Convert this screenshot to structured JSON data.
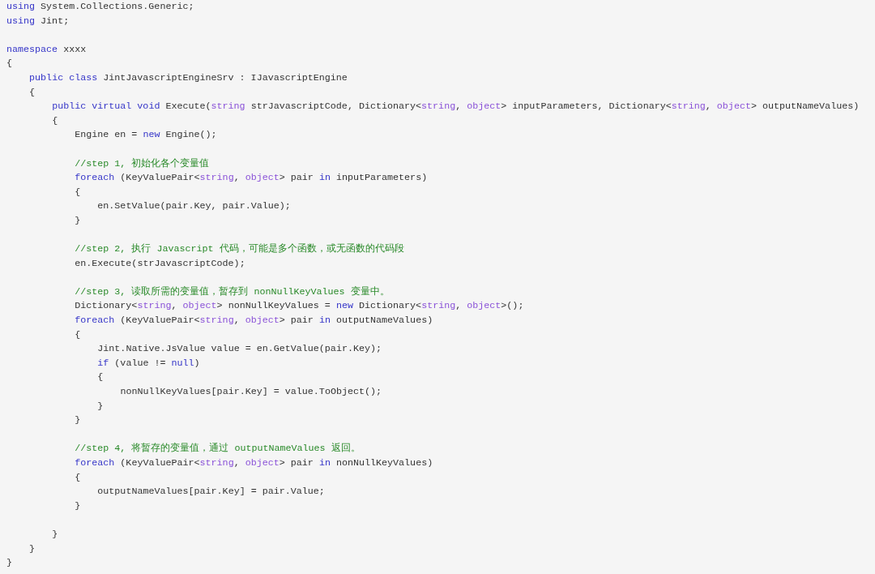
{
  "code_lines": [
    {
      "kind": "code",
      "tokens": [
        {
          "kind": "keyword",
          "text": "using"
        },
        {
          "kind": "plain",
          "text": " System.Collections.Generic;"
        }
      ]
    },
    {
      "kind": "code",
      "tokens": [
        {
          "kind": "keyword",
          "text": "using"
        },
        {
          "kind": "plain",
          "text": " Jint;"
        }
      ]
    },
    {
      "kind": "blank"
    },
    {
      "kind": "code",
      "tokens": [
        {
          "kind": "keyword",
          "text": "namespace"
        },
        {
          "kind": "plain",
          "text": " xxxx"
        }
      ]
    },
    {
      "kind": "code",
      "tokens": [
        {
          "kind": "plain",
          "text": "{"
        }
      ],
      "children": [
        {
          "kind": "code",
          "tokens": [
            {
              "kind": "keyword",
              "text": "public class"
            },
            {
              "kind": "plain",
              "text": " JintJavascriptEngineSrv : IJavascriptEngine"
            }
          ]
        },
        {
          "kind": "code",
          "tokens": [
            {
              "kind": "plain",
              "text": "{"
            }
          ],
          "children": [
            {
              "kind": "code",
              "tokens": [
                {
                  "kind": "keyword",
                  "text": "public virtual void"
                },
                {
                  "kind": "plain",
                  "text": " Execute("
                },
                {
                  "kind": "type",
                  "text": "string"
                },
                {
                  "kind": "plain",
                  "text": " strJavascriptCode, Dictionary<"
                },
                {
                  "kind": "type",
                  "text": "string"
                },
                {
                  "kind": "plain",
                  "text": ", "
                },
                {
                  "kind": "type",
                  "text": "object"
                },
                {
                  "kind": "plain",
                  "text": "> inputParameters, Dictionary<"
                },
                {
                  "kind": "type",
                  "text": "string"
                },
                {
                  "kind": "plain",
                  "text": ", "
                },
                {
                  "kind": "type",
                  "text": "object"
                },
                {
                  "kind": "plain",
                  "text": "> outputNameValues)"
                }
              ]
            },
            {
              "kind": "code",
              "tokens": [
                {
                  "kind": "plain",
                  "text": "{"
                }
              ],
              "children": [
                {
                  "kind": "code",
                  "tokens": [
                    {
                      "kind": "plain",
                      "text": "Engine en = "
                    },
                    {
                      "kind": "keyword",
                      "text": "new"
                    },
                    {
                      "kind": "plain",
                      "text": " Engine();"
                    }
                  ]
                },
                {
                  "kind": "blank"
                },
                {
                  "kind": "code",
                  "tokens": [
                    {
                      "kind": "comment",
                      "text": "//step 1, 初始化各个变量值"
                    }
                  ]
                },
                {
                  "kind": "code",
                  "tokens": [
                    {
                      "kind": "keyword",
                      "text": "foreach"
                    },
                    {
                      "kind": "plain",
                      "text": " (KeyValuePair<"
                    },
                    {
                      "kind": "type",
                      "text": "string"
                    },
                    {
                      "kind": "plain",
                      "text": ", "
                    },
                    {
                      "kind": "type",
                      "text": "object"
                    },
                    {
                      "kind": "plain",
                      "text": "> pair "
                    },
                    {
                      "kind": "keyword",
                      "text": "in"
                    },
                    {
                      "kind": "plain",
                      "text": " inputParameters)"
                    }
                  ]
                },
                {
                  "kind": "code",
                  "tokens": [
                    {
                      "kind": "plain",
                      "text": "{"
                    }
                  ],
                  "children": [
                    {
                      "kind": "code",
                      "tokens": [
                        {
                          "kind": "plain",
                          "text": "en.SetValue(pair.Key, pair.Value);"
                        }
                      ]
                    }
                  ]
                },
                {
                  "kind": "code",
                  "tokens": [
                    {
                      "kind": "plain",
                      "text": "}"
                    }
                  ]
                },
                {
                  "kind": "blank"
                },
                {
                  "kind": "code",
                  "tokens": [
                    {
                      "kind": "comment",
                      "text": "//step 2, 执行 Javascript 代码，可能是多个函数，或无函数的代码段"
                    }
                  ]
                },
                {
                  "kind": "code",
                  "tokens": [
                    {
                      "kind": "plain",
                      "text": "en.Execute(strJavascriptCode);"
                    }
                  ]
                },
                {
                  "kind": "blank"
                },
                {
                  "kind": "code",
                  "tokens": [
                    {
                      "kind": "comment",
                      "text": "//step 3, 读取所需的变量值，暂存到 nonNullKeyValues 变量中。"
                    }
                  ]
                },
                {
                  "kind": "code",
                  "tokens": [
                    {
                      "kind": "plain",
                      "text": "Dictionary<"
                    },
                    {
                      "kind": "type",
                      "text": "string"
                    },
                    {
                      "kind": "plain",
                      "text": ", "
                    },
                    {
                      "kind": "type",
                      "text": "object"
                    },
                    {
                      "kind": "plain",
                      "text": "> nonNullKeyValues = "
                    },
                    {
                      "kind": "keyword",
                      "text": "new"
                    },
                    {
                      "kind": "plain",
                      "text": " Dictionary<"
                    },
                    {
                      "kind": "type",
                      "text": "string"
                    },
                    {
                      "kind": "plain",
                      "text": ", "
                    },
                    {
                      "kind": "type",
                      "text": "object"
                    },
                    {
                      "kind": "plain",
                      "text": ">();"
                    }
                  ]
                },
                {
                  "kind": "code",
                  "tokens": [
                    {
                      "kind": "keyword",
                      "text": "foreach"
                    },
                    {
                      "kind": "plain",
                      "text": " (KeyValuePair<"
                    },
                    {
                      "kind": "type",
                      "text": "string"
                    },
                    {
                      "kind": "plain",
                      "text": ", "
                    },
                    {
                      "kind": "type",
                      "text": "object"
                    },
                    {
                      "kind": "plain",
                      "text": "> pair "
                    },
                    {
                      "kind": "keyword",
                      "text": "in"
                    },
                    {
                      "kind": "plain",
                      "text": " outputNameValues)"
                    }
                  ]
                },
                {
                  "kind": "code",
                  "tokens": [
                    {
                      "kind": "plain",
                      "text": "{"
                    }
                  ],
                  "children": [
                    {
                      "kind": "code",
                      "tokens": [
                        {
                          "kind": "plain",
                          "text": "Jint.Native.JsValue value = en.GetValue(pair.Key);"
                        }
                      ]
                    },
                    {
                      "kind": "code",
                      "tokens": [
                        {
                          "kind": "keyword",
                          "text": "if"
                        },
                        {
                          "kind": "plain",
                          "text": " (value != "
                        },
                        {
                          "kind": "keyword",
                          "text": "null"
                        },
                        {
                          "kind": "plain",
                          "text": ")"
                        }
                      ]
                    },
                    {
                      "kind": "code",
                      "tokens": [
                        {
                          "kind": "plain",
                          "text": "{"
                        }
                      ],
                      "children": [
                        {
                          "kind": "code",
                          "tokens": [
                            {
                              "kind": "plain",
                              "text": "nonNullKeyValues[pair.Key] = value.ToObject();"
                            }
                          ]
                        }
                      ]
                    },
                    {
                      "kind": "code",
                      "tokens": [
                        {
                          "kind": "plain",
                          "text": "}"
                        }
                      ]
                    }
                  ]
                },
                {
                  "kind": "code",
                  "tokens": [
                    {
                      "kind": "plain",
                      "text": "}"
                    }
                  ]
                },
                {
                  "kind": "blank"
                },
                {
                  "kind": "code",
                  "tokens": [
                    {
                      "kind": "comment",
                      "text": "//step 4, 将暂存的变量值，通过 outputNameValues 返回。"
                    }
                  ]
                },
                {
                  "kind": "code",
                  "tokens": [
                    {
                      "kind": "keyword",
                      "text": "foreach"
                    },
                    {
                      "kind": "plain",
                      "text": " (KeyValuePair<"
                    },
                    {
                      "kind": "type",
                      "text": "string"
                    },
                    {
                      "kind": "plain",
                      "text": ", "
                    },
                    {
                      "kind": "type",
                      "text": "object"
                    },
                    {
                      "kind": "plain",
                      "text": "> pair "
                    },
                    {
                      "kind": "keyword",
                      "text": "in"
                    },
                    {
                      "kind": "plain",
                      "text": " nonNullKeyValues)"
                    }
                  ]
                },
                {
                  "kind": "code",
                  "tokens": [
                    {
                      "kind": "plain",
                      "text": "{"
                    }
                  ],
                  "children": [
                    {
                      "kind": "code",
                      "tokens": [
                        {
                          "kind": "plain",
                          "text": "outputNameValues[pair.Key] = pair.Value;"
                        }
                      ]
                    }
                  ]
                },
                {
                  "kind": "code",
                  "tokens": [
                    {
                      "kind": "plain",
                      "text": "}"
                    }
                  ]
                },
                {
                  "kind": "blank"
                }
              ]
            },
            {
              "kind": "code",
              "tokens": [
                {
                  "kind": "plain",
                  "text": "}"
                }
              ]
            }
          ]
        },
        {
          "kind": "code",
          "tokens": [
            {
              "kind": "plain",
              "text": "}"
            }
          ]
        }
      ]
    },
    {
      "kind": "code",
      "tokens": [
        {
          "kind": "plain",
          "text": "}"
        }
      ]
    }
  ]
}
